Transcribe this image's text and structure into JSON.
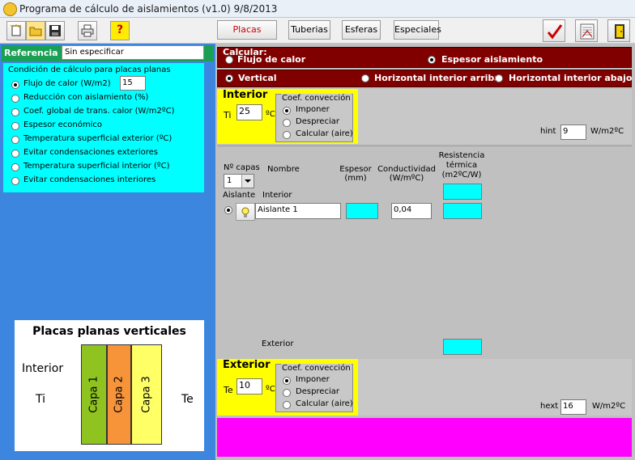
{
  "window": {
    "title": "Programa de cálculo de aislamientos (v1.0) 9/8/2013"
  },
  "toolbar": {
    "tabs": [
      "Placas planas",
      "Tuberias",
      "Esferas",
      "Especiales"
    ],
    "help_label": "?"
  },
  "colors": {
    "accent_red": "#800000",
    "active_tab_text": "#cc0000",
    "left_panel": "#3c86e0",
    "reference_bar": "#1aa055",
    "cyan_field": "#00ffff",
    "yellow_panel": "#ffff00",
    "magenta_panel": "#ff00ff"
  },
  "reference": {
    "label": "Referencia",
    "value": "Sin especificar"
  },
  "condition": {
    "title": "Condición de cálculo para placas planas",
    "options": [
      "Flujo de calor  (W/m2)",
      "Reducción con aislamiento (%)",
      "Coef. global de trans. calor (W/m2ºC)",
      "Espesor económico",
      "Temperatura superficial exterior (ºC)",
      "Evitar condensaciones exteriores",
      "Temperatura superficial interior (ºC)",
      "Evitar condensaciones interiores"
    ],
    "selected_index": 0,
    "value": "15"
  },
  "diagram": {
    "title": "Placas planas verticales",
    "interior": "Interior",
    "ti": "Ti",
    "te": "Te",
    "layers": [
      "Capa 1",
      "Capa 2",
      "Capa 3"
    ],
    "layer_colors": [
      "#8fc31f",
      "#f7943a",
      "#ffff66"
    ]
  },
  "calcular": {
    "title": "Calcular:",
    "options": [
      "Flujo de calor",
      "Espesor aislamiento"
    ],
    "selected_index": 1
  },
  "orientation": {
    "options": [
      "Vertical",
      "Horizontal interior arriba",
      "Horizontal interior abajo"
    ],
    "selected_index": 0
  },
  "interior": {
    "title": "Interior",
    "ti_label": "Ti",
    "ti_value": "25",
    "unit": "ºC",
    "conv_title": "Coef. convección",
    "conv_options": [
      "Imponer",
      "Despreciar",
      "Calcular (aire)"
    ],
    "conv_selected": 0,
    "h_label": "hint",
    "h_value": "9",
    "h_unit": "W/m2ºC"
  },
  "layers": {
    "n_label": "Nº capas",
    "n_value": "1",
    "col_nombre": "Nombre",
    "col_espesor": "Espesor\n(mm)",
    "col_conductividad": "Conductividad\n(W/mºC)",
    "col_resistencia": "Resistencia\ntérmica\n(m2ºC/W)",
    "aislante_label": "Aislante",
    "interior_label": "Interior",
    "row_name": "Aislante 1",
    "row_conductividad": "0,04",
    "exterior_label": "Exterior"
  },
  "exterior": {
    "title": "Exterior",
    "te_label": "Te",
    "te_value": "10",
    "unit": "ºC",
    "conv_title": "Coef. convección",
    "conv_options": [
      "Imponer",
      "Despreciar",
      "Calcular (aire)"
    ],
    "conv_selected": 0,
    "h_label": "hext",
    "h_value": "16",
    "h_unit": "W/m2ºC"
  }
}
